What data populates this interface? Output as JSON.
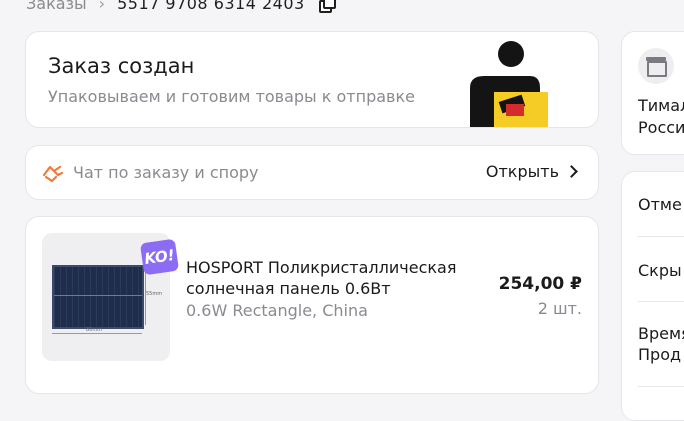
{
  "breadcrumb": {
    "section": "Заказы",
    "separator": "›",
    "order_number": "5517 9708 6314 2403"
  },
  "status_card": {
    "title": "Заказ создан",
    "subtitle": "Упаковываем и готовим товары к отправке"
  },
  "chat_card": {
    "label": "Чат по заказу и спору",
    "action": "Открыть"
  },
  "product": {
    "badge": "KO!",
    "name": "HOSPORT Поликристаллическая солнечная панель 0.6Вт",
    "variant": "0.6W Rectangle, China",
    "price": "254,00 ₽",
    "quantity": "2 шт.",
    "image_labels": {
      "width": "80mm",
      "height": "55mm"
    }
  },
  "side_panel": {
    "seller_lines": [
      "Тимал",
      "Росси"
    ],
    "actions": [
      "Отме",
      "Скры",
      "Время",
      "Прод"
    ]
  }
}
